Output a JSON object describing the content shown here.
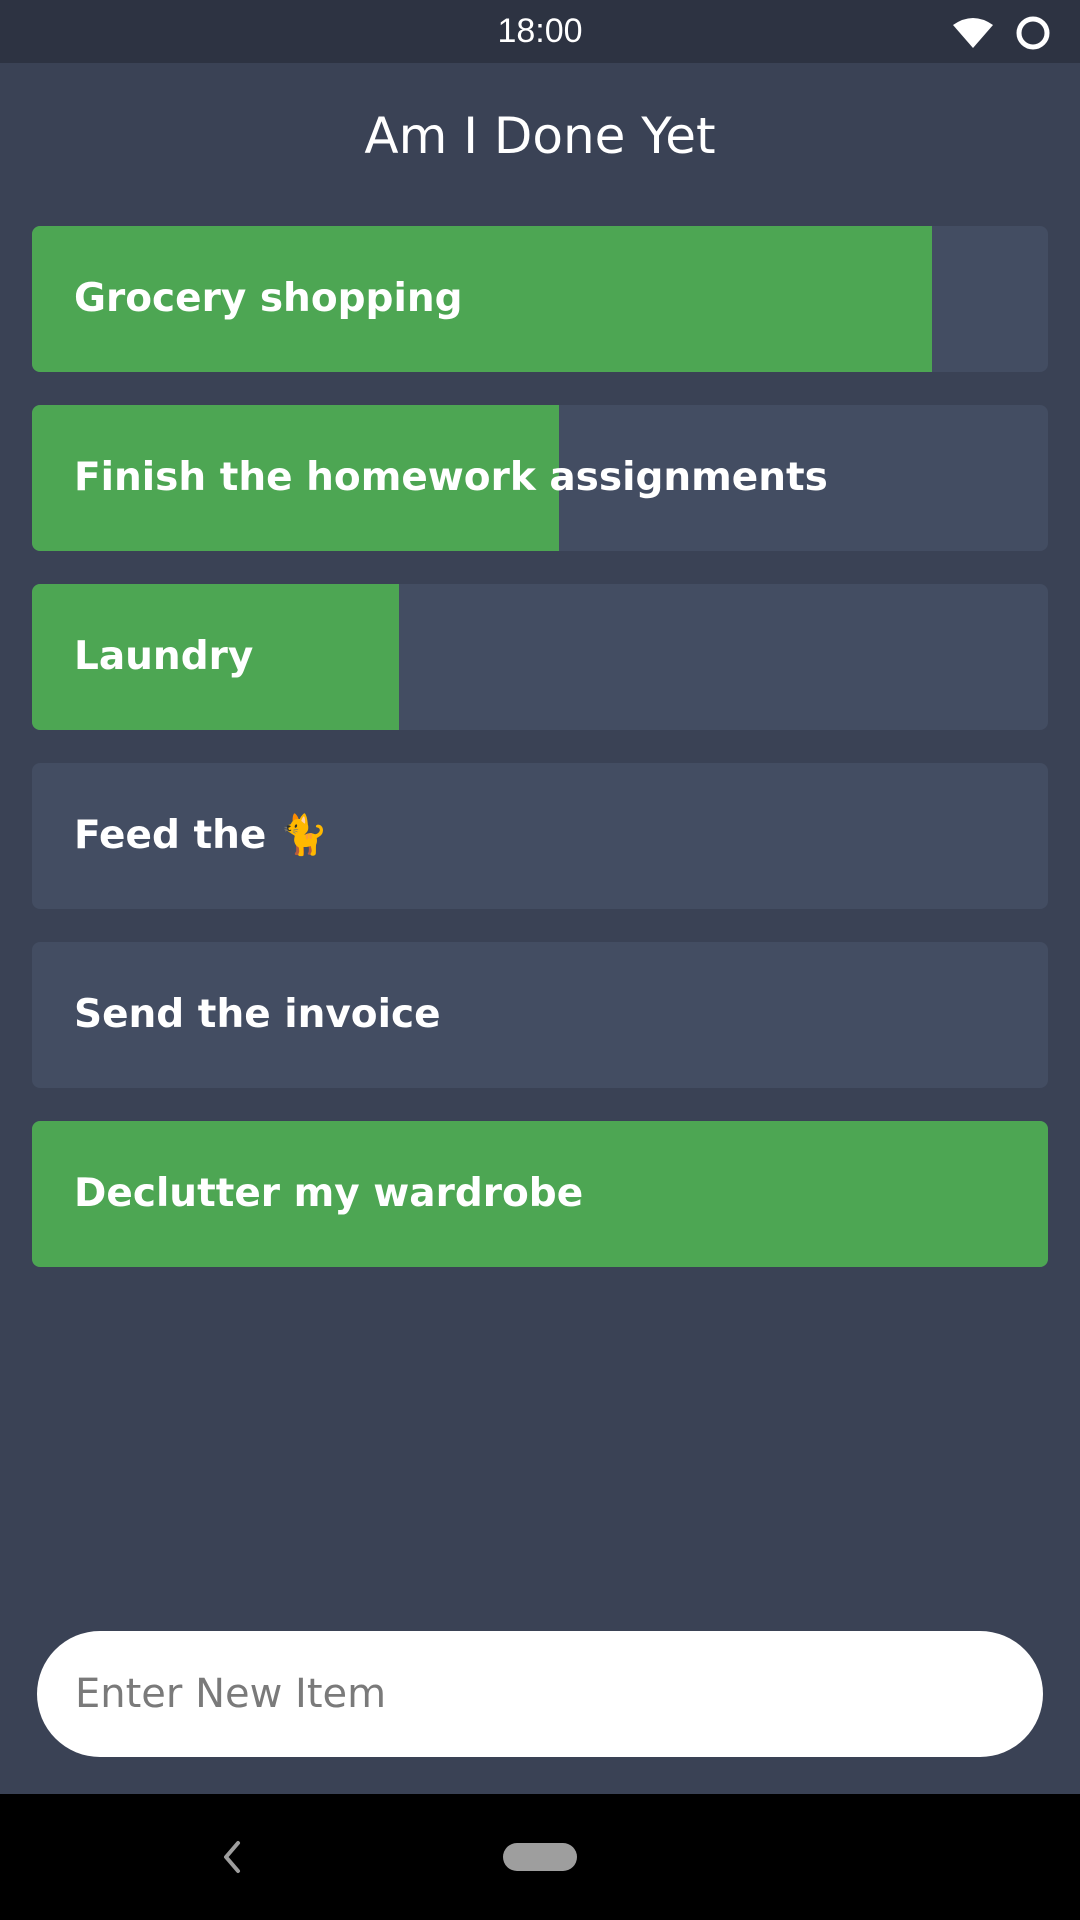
{
  "status_bar": {
    "time": "18:00",
    "icons": [
      "wifi-icon",
      "circle-icon"
    ]
  },
  "app": {
    "title": "Am I Done Yet"
  },
  "tasks": [
    {
      "label": "Grocery shopping",
      "progress": 0.886
    },
    {
      "label": "Finish the homework assignments",
      "progress": 0.519
    },
    {
      "label": "Laundry",
      "progress": 0.361
    },
    {
      "label": "Feed the 🐈",
      "progress": 0.0
    },
    {
      "label": "Send the invoice",
      "progress": 0.0
    },
    {
      "label": "Declutter my wardrobe",
      "progress": 1.0
    }
  ],
  "new_item": {
    "placeholder": "Enter New Item",
    "value": ""
  },
  "nav_bar": {
    "icons": [
      "back-icon",
      "home-pill"
    ]
  },
  "colors": {
    "background": "#3a4255",
    "status_bar": "#2d3342",
    "item_background": "#434d62",
    "progress_fill": "#4da653",
    "text": "#ffffff"
  }
}
